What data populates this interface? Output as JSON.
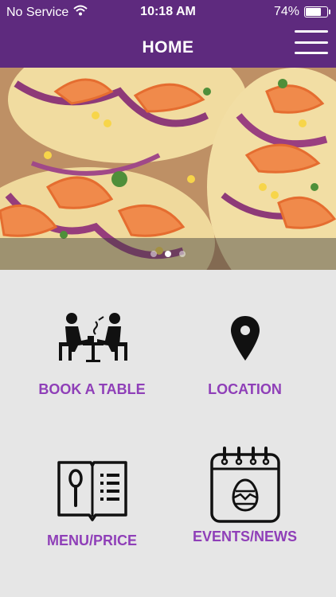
{
  "status_bar": {
    "carrier": "No Service",
    "time": "10:18 AM",
    "battery": "74%",
    "battery_level": 0.74
  },
  "header": {
    "title": "HOME"
  },
  "hero": {
    "slide_count": 3,
    "active_slide": 1
  },
  "tiles": [
    {
      "label": "BOOK A TABLE",
      "icon": "dining-table-icon"
    },
    {
      "label": "LOCATION",
      "icon": "map-pin-icon"
    },
    {
      "label": "MENU/PRICE",
      "icon": "menu-book-icon"
    },
    {
      "label": "EVENTS/NEWS",
      "icon": "calendar-egg-icon"
    }
  ],
  "colors": {
    "header": "#5e2a7e",
    "accent": "#8f3fb8",
    "background": "#e6e6e6"
  }
}
